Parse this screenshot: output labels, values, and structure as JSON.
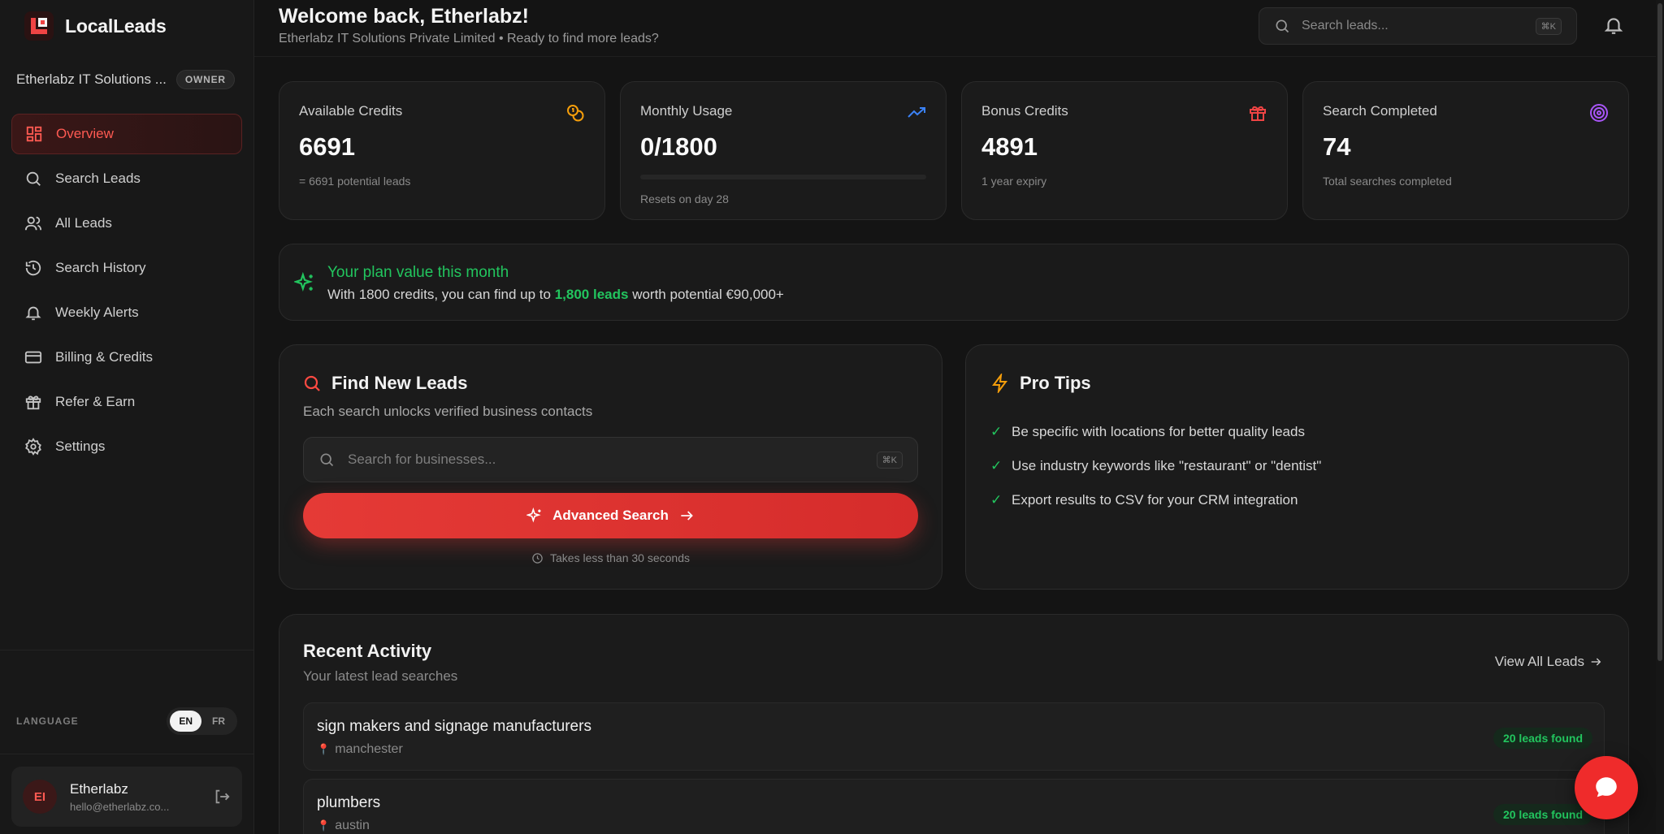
{
  "app": {
    "name": "LocalLeads"
  },
  "org": {
    "name": "Etherlabz IT Solutions ...",
    "role_badge": "OWNER"
  },
  "nav": {
    "items": [
      {
        "label": "Overview",
        "icon": "grid-icon",
        "active": true
      },
      {
        "label": "Search Leads",
        "icon": "search-icon"
      },
      {
        "label": "All Leads",
        "icon": "users-icon"
      },
      {
        "label": "Search History",
        "icon": "history-icon"
      },
      {
        "label": "Weekly Alerts",
        "icon": "bell-icon"
      },
      {
        "label": "Billing & Credits",
        "icon": "credit-card-icon"
      },
      {
        "label": "Refer & Earn",
        "icon": "gift-icon"
      },
      {
        "label": "Settings",
        "icon": "gear-icon"
      }
    ]
  },
  "language": {
    "label": "LANGUAGE",
    "options": [
      "EN",
      "FR"
    ],
    "selected": "EN"
  },
  "user": {
    "initials": "EI",
    "name": "Etherlabz",
    "email": "hello@etherlabz.co..."
  },
  "header": {
    "welcome": "Welcome back, Etherlabz!",
    "subtitle": "Etherlabz IT Solutions Private Limited • Ready to find more leads?",
    "search_placeholder": "Search leads...",
    "search_shortcut": "⌘K"
  },
  "stats": [
    {
      "title": "Available Credits",
      "value": "6691",
      "note": "= 6691 potential leads",
      "icon": "coins-icon",
      "icon_color": "#f59e0b"
    },
    {
      "title": "Monthly Usage",
      "value": "0/1800",
      "note": "Resets on day 28",
      "icon": "trending-up-icon",
      "icon_color": "#3b82f6",
      "progress_fraction": 0.0
    },
    {
      "title": "Bonus Credits",
      "value": "4891",
      "note": "1 year expiry",
      "icon": "gift-icon",
      "icon_color": "#ef4444"
    },
    {
      "title": "Search Completed",
      "value": "74",
      "note": "Total searches completed",
      "icon": "target-icon",
      "icon_color": "#a855f7"
    }
  ],
  "plan": {
    "title": "Your plan value this month",
    "text_before": "With 1800 credits, you can find up to ",
    "highlight": "1,800 leads",
    "text_after": " worth potential €90,000+"
  },
  "find": {
    "title": "Find New Leads",
    "subtitle": "Each search unlocks verified business contacts",
    "search_placeholder": "Search for businesses...",
    "search_shortcut": "⌘K",
    "button_label": "Advanced Search",
    "note": "Takes less than 30 seconds"
  },
  "tips": {
    "title": "Pro Tips",
    "items": [
      "Be specific with locations for better quality leads",
      "Use industry keywords like \"restaurant\" or \"dentist\"",
      "Export results to CSV for your CRM integration"
    ]
  },
  "recent": {
    "title": "Recent Activity",
    "subtitle": "Your latest lead searches",
    "view_all": "View All Leads",
    "rows": [
      {
        "query": "sign makers and signage manufacturers",
        "location": "manchester",
        "badge": "20 leads found"
      },
      {
        "query": "plumbers",
        "location": "austin",
        "badge": "20 leads found"
      }
    ]
  },
  "colors": {
    "accent": "#ef4444",
    "success": "#22c55e",
    "background": "#141414"
  }
}
